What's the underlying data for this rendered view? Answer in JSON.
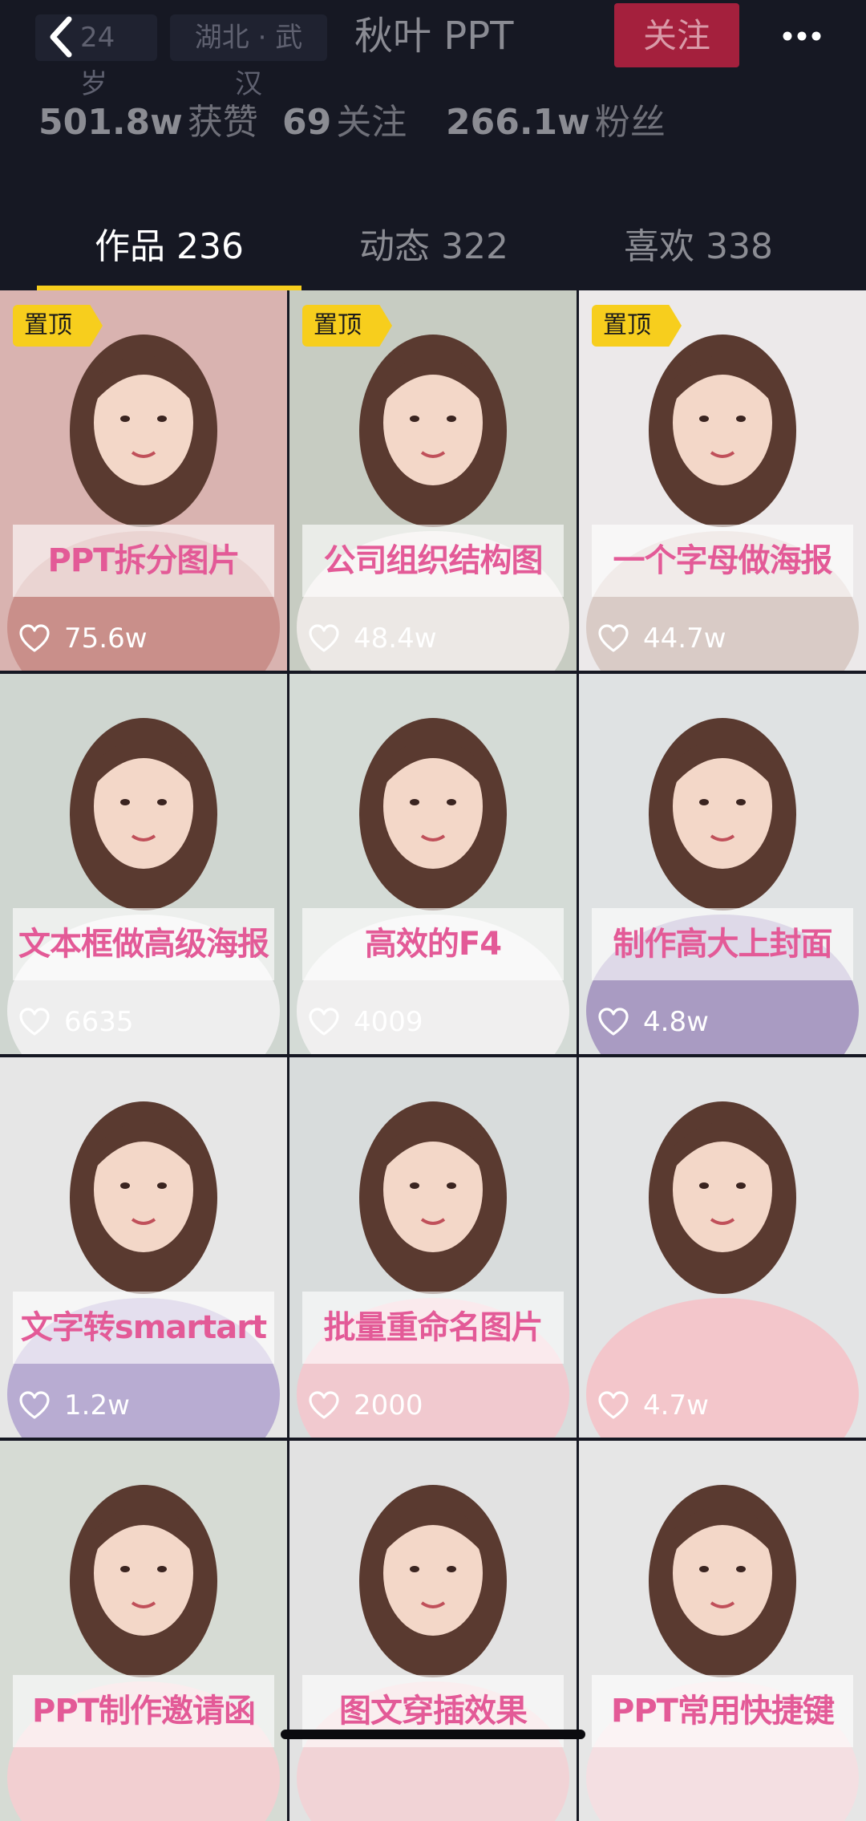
{
  "header": {
    "age_tag": "24 岁",
    "location_tag": "湖北 · 武汉",
    "name": "秋叶 PPT",
    "follow_label": "关注"
  },
  "stats": [
    {
      "num": "501.8w",
      "label": "获赞"
    },
    {
      "num": "69",
      "label": "关注"
    },
    {
      "num": "266.1w",
      "label": "粉丝"
    }
  ],
  "tabs": [
    {
      "label": "作品 236",
      "active": true
    },
    {
      "label": "动态 322",
      "active": false
    },
    {
      "label": "喜欢 338",
      "active": false
    }
  ],
  "pin_label": "置顶",
  "videos": [
    {
      "caption": "PPT拆分图片",
      "likes": "75.6w",
      "pinned": true,
      "bg": "#d9b3b0",
      "shirt": "#c98f8a"
    },
    {
      "caption": "公司组织结构图",
      "likes": "48.4w",
      "pinned": true,
      "bg": "#c7ccc2",
      "shirt": "#ece8e5"
    },
    {
      "caption": "一个字母做海报",
      "likes": "44.7w",
      "pinned": true,
      "bg": "#ece9ea",
      "shirt": "#d9cbc6"
    },
    {
      "caption": "文本框做高级海报",
      "likes": "6635",
      "pinned": false,
      "bg": "#cfd6d0",
      "shirt": "#eeeeee"
    },
    {
      "caption": "高效的F4",
      "likes": "4009",
      "pinned": false,
      "bg": "#d4dbd6",
      "shirt": "#f0efef"
    },
    {
      "caption": "制作高大上封面",
      "likes": "4.8w",
      "pinned": false,
      "bg": "#dfe2e3",
      "shirt": "#a99bc2"
    },
    {
      "caption": "文字转smartart",
      "likes": "1.2w",
      "pinned": false,
      "bg": "#e6e6e6",
      "shirt": "#b8acd2"
    },
    {
      "caption": "批量重命名图片",
      "likes": "2000",
      "pinned": false,
      "bg": "#d8dcdc",
      "shirt": "#f1c9cf"
    },
    {
      "caption": "",
      "likes": "4.7w",
      "pinned": false,
      "bg": "#e3e4e5",
      "shirt": "#f3c6cb"
    },
    {
      "caption": "PPT制作邀请函",
      "likes": "",
      "pinned": false,
      "bg": "#d6dbd4",
      "shirt": "#f2cfd1"
    },
    {
      "caption": "图文穿插效果",
      "likes": "",
      "pinned": false,
      "bg": "#e2e2e2",
      "shirt": "#f1d3d6"
    },
    {
      "caption": "PPT常用快捷键",
      "likes": "",
      "pinned": false,
      "bg": "#e6e6e6",
      "shirt": "#f4dfe2"
    }
  ],
  "colors": {
    "background": "#161823",
    "follow_button": "#a4203d",
    "tab_underline": "#f7ce1d",
    "pin_badge": "#f7ce1d",
    "caption_text": "#e35a97"
  }
}
